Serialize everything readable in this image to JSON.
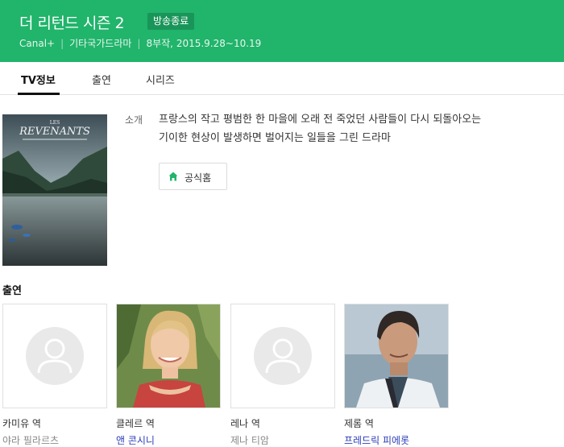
{
  "header": {
    "title": "더 리턴드 시즌 2",
    "status_badge": "방송종료",
    "network": "Canal+",
    "genre": "기타국가드라마",
    "episodes_dates": "8부작, 2015.9.28~10.19"
  },
  "tabs": [
    {
      "label": "TV정보",
      "active": true
    },
    {
      "label": "출연",
      "active": false
    },
    {
      "label": "시리즈",
      "active": false
    }
  ],
  "poster": {
    "title_small": "LES",
    "title": "REVENANTS"
  },
  "intro": {
    "label": "소개",
    "text_line1": "프랑스의 작고 평범한 한 마을에 오래 전 죽었던 사람들이 다시 되돌아오는",
    "text_line2": "기이한 현상이 발생하면 벌어지는 일들을 그린 드라마"
  },
  "home_button": {
    "label": "공식홈",
    "icon": "home-icon"
  },
  "cast": {
    "heading": "출연",
    "members": [
      {
        "role": "카미유 역",
        "actor": "야라 필라르츠",
        "linked": false,
        "photo": "placeholder"
      },
      {
        "role": "클레르 역",
        "actor": "앤 콘시니",
        "linked": true,
        "photo": "woman"
      },
      {
        "role": "레나 역",
        "actor": "제나 티암",
        "linked": false,
        "photo": "placeholder"
      },
      {
        "role": "제롬 역",
        "actor": "프레드릭 피에롯",
        "linked": true,
        "photo": "man"
      }
    ]
  },
  "colors": {
    "brand_green": "#21b46b",
    "badge_green": "#1a955a",
    "link_blue": "#2a3db8"
  }
}
